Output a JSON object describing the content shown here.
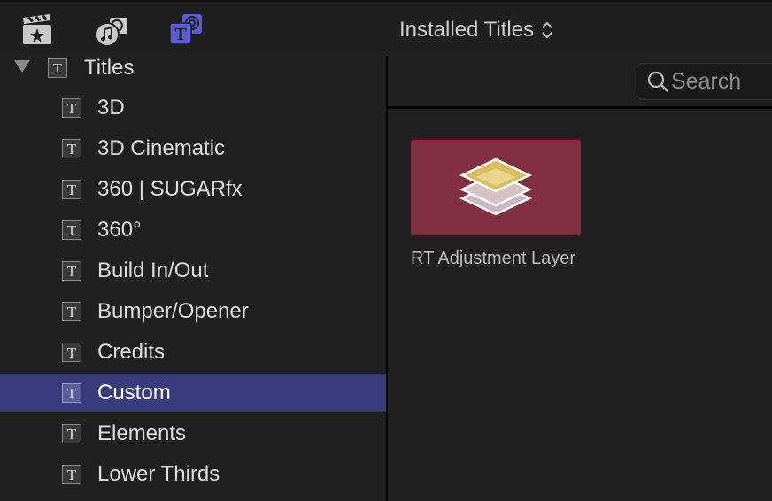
{
  "toolbar": {
    "icons": [
      {
        "name": "photos-video-icon",
        "active": false
      },
      {
        "name": "music-sound-icon",
        "active": false
      },
      {
        "name": "titles-generators-icon",
        "active": true
      }
    ],
    "browser_title": "Installed Titles",
    "accent_color": "#4b4aa8"
  },
  "sidebar": {
    "root": {
      "label": "Titles",
      "expanded": true
    },
    "items": [
      {
        "label": "3D",
        "selected": false
      },
      {
        "label": "3D Cinematic",
        "selected": false
      },
      {
        "label": "360 | SUGARfx",
        "selected": false
      },
      {
        "label": "360°",
        "selected": false
      },
      {
        "label": "Build In/Out",
        "selected": false
      },
      {
        "label": "Bumper/Opener",
        "selected": false
      },
      {
        "label": "Credits",
        "selected": false
      },
      {
        "label": "Custom",
        "selected": true
      },
      {
        "label": "Elements",
        "selected": false
      },
      {
        "label": "Lower Thirds",
        "selected": false
      }
    ],
    "selection_color": "#383c7a"
  },
  "search": {
    "placeholder": "Search",
    "value": ""
  },
  "content": {
    "items": [
      {
        "name": "RT Adjustment Layer",
        "thumbnail_color": "#822f41",
        "icon": "layers-icon"
      }
    ]
  }
}
